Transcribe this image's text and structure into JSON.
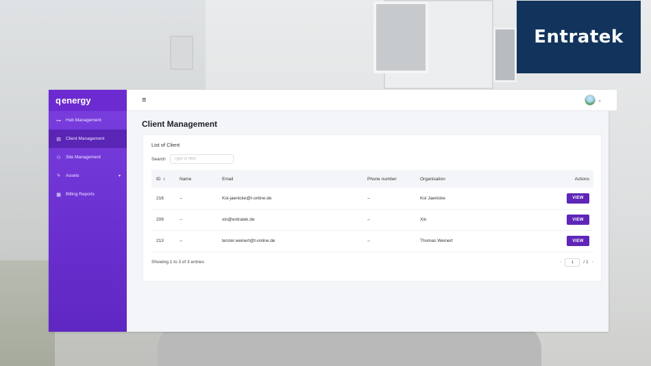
{
  "brand": {
    "name": "Entratek"
  },
  "app": {
    "logo_text": "energy",
    "logo_mark": "q",
    "sidebar": {
      "items": [
        {
          "label": "Hub Management",
          "icon": "hub-icon",
          "active": false
        },
        {
          "label": "Client Management",
          "icon": "client-icon",
          "active": true
        },
        {
          "label": "Site Management",
          "icon": "site-icon",
          "active": false
        },
        {
          "label": "Assets",
          "icon": "bolt-icon",
          "active": false,
          "expandable": true
        },
        {
          "label": "Billing Reports",
          "icon": "report-icon",
          "active": false
        }
      ]
    },
    "topbar": {
      "menu_icon": "hamburger-icon",
      "avatar": "avatar"
    },
    "page_title": "Client Management",
    "card": {
      "title": "List of Client",
      "search_label": "Search",
      "search_placeholder": "Type to filter",
      "table": {
        "headers": [
          "ID",
          "Name",
          "Email",
          "Phone number",
          "Organisation",
          "Actions"
        ],
        "rows": [
          {
            "id": "216",
            "name": "--",
            "email": "Koi-jaenicke@t-online.de",
            "phone": "--",
            "org": "Koi Jaenicke",
            "action": "VIEW"
          },
          {
            "id": "209",
            "name": "--",
            "email": "xin@entratek.de",
            "phone": "--",
            "org": "Xin",
            "action": "VIEW"
          },
          {
            "id": "213",
            "name": "--",
            "email": "tenzer.weinert@t-online.de",
            "phone": "--",
            "org": "Thomas Weinert",
            "action": "VIEW"
          }
        ]
      },
      "entries_info": "Showing 1 to 3 of 3 entries",
      "pager": {
        "current": "1",
        "total": "/ 1"
      }
    },
    "colors": {
      "sidebar": "#6a2fcf",
      "accent": "#5f26b8",
      "brand_box": "#12345c"
    }
  }
}
